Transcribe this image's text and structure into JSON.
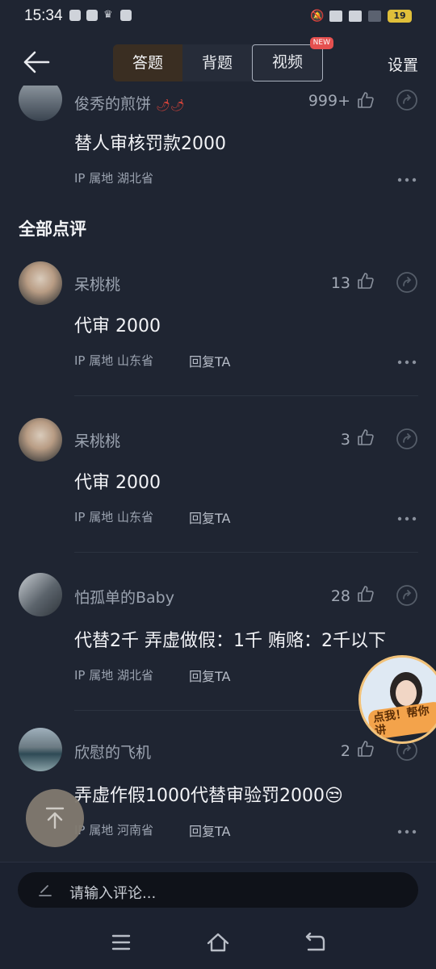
{
  "status_bar": {
    "time": "15:34",
    "battery": "19"
  },
  "header": {
    "tabs": [
      {
        "label": "答题"
      },
      {
        "label": "背题"
      },
      {
        "label": "视频"
      }
    ],
    "new_badge": "NEW",
    "settings_label": "设置"
  },
  "top_comment": {
    "user": "俊秀的煎饼",
    "likes": "999+",
    "text": "替人审核罚款2000",
    "location": "IP 属地 湖北省"
  },
  "section_title": "全部点评",
  "comments": [
    {
      "user": "呆桃桃",
      "likes": "13",
      "text": "代审 2000",
      "location": "IP 属地 山东省",
      "reply": "回复TA"
    },
    {
      "user": "呆桃桃",
      "likes": "3",
      "text": "代审 2000",
      "location": "IP 属地 山东省",
      "reply": "回复TA"
    },
    {
      "user": "怕孤单的Baby",
      "likes": "28",
      "text": "代替2千 弄虚做假：1千 贿赂：2千以下",
      "location": "IP 属地 湖北省",
      "reply": "回复TA"
    },
    {
      "user": "欣慰的飞机",
      "likes": "2",
      "text": "弄虚作假1000代替审验罚2000😒",
      "location": "IP 属地 河南省",
      "reply": "回复TA"
    }
  ],
  "float_ad": {
    "label": "点我！帮你讲"
  },
  "comment_input": {
    "placeholder": "请输入评论..."
  }
}
